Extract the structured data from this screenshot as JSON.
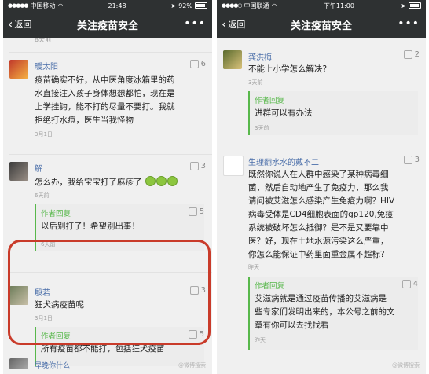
{
  "left": {
    "status": {
      "carrier": "中国移动",
      "wifi": "wifi",
      "time": "21:48",
      "battery": "92%",
      "battery_level": 0.92
    },
    "nav": {
      "back": "返回",
      "title": "关注疫苗安全",
      "more": "•••"
    },
    "top_cut_text": "8天前",
    "comments": [
      {
        "nick": "暖太阳",
        "likes": "6",
        "text": [
          "疫苗确实不好，从中医角度冰箱里的药",
          "水直接注入孩子身体想想都怕，现在是",
          "上学挂钩，能不打的尽量不要打。我就",
          "拒绝打水痘，医生当我怪物"
        ],
        "time": "3月1日"
      },
      {
        "nick": "解",
        "likes": "3",
        "text": [
          "怎么办，我给宝宝打了麻疹了"
        ],
        "time": "6天前",
        "reply": {
          "label": "作者回复",
          "likes": "5",
          "text": [
            "以后别打了！希望别出事！"
          ],
          "time": "6天前"
        }
      },
      {
        "nick": "殷若",
        "likes": "3",
        "text": [
          "狂犬病疫苗呢"
        ],
        "time": "3月1日",
        "reply": {
          "label": "作者回复",
          "likes": "5",
          "text": [
            "所有疫苗都不能打，包括狂犬疫苗"
          ],
          "time": ""
        }
      }
    ],
    "bottom_cut_nick": "早晚你什么",
    "watermark": "@微博搜索"
  },
  "right": {
    "status": {
      "carrier": "中国联通",
      "wifi": "wifi",
      "time": "下午11:00",
      "battery": "",
      "battery_level": 0.9
    },
    "nav": {
      "back": "返回",
      "title": "关注疫苗安全",
      "more": "•••"
    },
    "comments": [
      {
        "nick": "龚洪梅",
        "likes": "2",
        "text": [
          "不能上小学怎么解决?"
        ],
        "time": "3天前",
        "reply": {
          "label": "作者回复",
          "likes": "",
          "text": [
            "进群可以有办法"
          ],
          "time": "3天前"
        }
      },
      {
        "nick": "生理翻水水的戴不二",
        "likes": "3",
        "text": [
          "既然你说人在人群中感染了某种病毒细",
          "菌，然后自动地产生了免疫力，那么我",
          "请问被艾滋怎么感染产生免疫力啊？HIV",
          "病毒受体是CD4细胞表面的gp120,免疫",
          "系统被破坏怎么抵御？是不是又要靠中",
          "医？好，现在土地水源污染这么严重，",
          "你怎么能保证中药里面重金属不超标?"
        ],
        "time": "昨天",
        "reply": {
          "label": "作者回复",
          "likes": "4",
          "text": [
            "艾滋病就是通过疫苗传播的艾滋病是",
            "些专家们发明出来的，本公号之前的文",
            "章有你可以去找找看"
          ],
          "time": "昨天"
        }
      }
    ],
    "watermark": "@微博搜索"
  },
  "colors": {
    "navbar": "#2e3132",
    "author_green": "#58b84b",
    "nick_blue": "#4a6ea9",
    "mark_red": "#c93b2a"
  }
}
